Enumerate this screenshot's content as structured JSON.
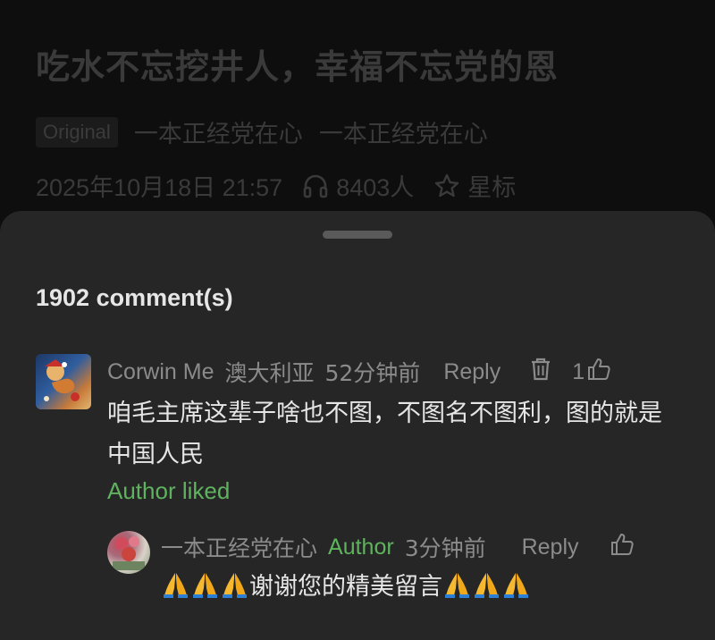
{
  "article": {
    "title": "吃水不忘挖井人，幸福不忘党的恩",
    "badge": "Original",
    "author": "一本正经党在心",
    "account": "一本正经党在心",
    "date": "2025年10月18日 21:57",
    "listeners": "8403人",
    "star_label": "星标"
  },
  "sheet": {
    "comment_count": "1902 comment(s)"
  },
  "comment": {
    "name": "Corwin Me",
    "location": "澳大利亚",
    "time": "52分钟前",
    "reply_label": "Reply",
    "likes": "1",
    "text": "咱毛主席这辈子啥也不图，不图名不图利，图的就是中国人民",
    "author_liked": "Author liked"
  },
  "reply": {
    "name": "一本正经党在心",
    "author_tag": "Author",
    "time": "3分钟前",
    "reply_label": "Reply",
    "text": "谢谢您的精美留言",
    "emoji": "pray-hands"
  },
  "colors": {
    "accent_green": "#5fb35f",
    "sheet_bg": "#262626",
    "page_bg": "#0b0b0b"
  }
}
